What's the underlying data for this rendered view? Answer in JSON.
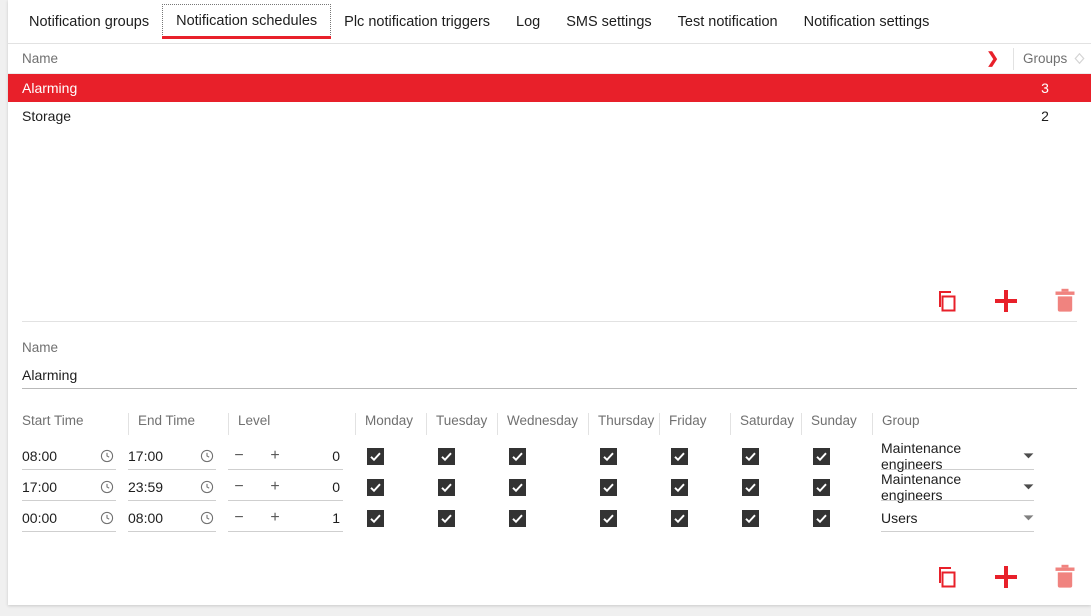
{
  "tabs": [
    {
      "label": "Notification groups",
      "active": false
    },
    {
      "label": "Notification schedules",
      "active": true
    },
    {
      "label": "Plc notification triggers",
      "active": false
    },
    {
      "label": "Log",
      "active": false
    },
    {
      "label": "SMS settings",
      "active": false
    },
    {
      "label": "Test notification",
      "active": false
    },
    {
      "label": "Notification settings",
      "active": false
    }
  ],
  "schedule_list": {
    "columns": {
      "name": "Name",
      "groups": "Groups"
    },
    "sort": {
      "name_icon": "chevron-down-icon",
      "groups_icon": "sort-diamond-icon"
    },
    "rows": [
      {
        "name": "Alarming",
        "groups": "3",
        "selected": true
      },
      {
        "name": "Storage",
        "groups": "2",
        "selected": false
      }
    ]
  },
  "list_actions": {
    "copy_label": "copy-icon",
    "add_label": "plus-icon",
    "delete_label": "trash-icon"
  },
  "detail": {
    "name_label": "Name",
    "name_value": "Alarming",
    "name_placeholder": "Name",
    "columns": {
      "start_time": "Start Time",
      "end_time": "End Time",
      "level": "Level",
      "monday": "Monday",
      "tuesday": "Tuesday",
      "wednesday": "Wednesday",
      "thursday": "Thursday",
      "friday": "Friday",
      "saturday": "Saturday",
      "sunday": "Sunday",
      "group": "Group"
    },
    "rows": [
      {
        "start_time": "08:00",
        "end_time": "17:00",
        "level": "0",
        "monday": true,
        "tuesday": true,
        "wednesday": true,
        "thursday": true,
        "friday": true,
        "saturday": true,
        "sunday": true,
        "group": "Maintenance engineers",
        "group_spread": false
      },
      {
        "start_time": "17:00",
        "end_time": "23:59",
        "level": "0",
        "monday": true,
        "tuesday": true,
        "wednesday": true,
        "thursday": true,
        "friday": true,
        "saturday": true,
        "sunday": true,
        "group": "Maintenance engineers",
        "group_spread": false
      },
      {
        "start_time": "00:00",
        "end_time": "08:00",
        "level": "1",
        "monday": true,
        "tuesday": true,
        "wednesday": true,
        "thursday": true,
        "friday": true,
        "saturday": true,
        "sunday": true,
        "group": "Users",
        "group_spread": true
      }
    ],
    "stepper": {
      "minus": "−",
      "plus": "+"
    }
  },
  "detail_actions": {
    "copy_label": "copy-icon",
    "add_label": "plus-icon",
    "delete_label": "trash-icon"
  },
  "colors": {
    "accent_red": "#e8202a",
    "accent_red_muted": "#f0837f",
    "checkbox_dark": "#333333",
    "text_muted": "#707070",
    "panel_bg": "#ffffff",
    "page_bg": "#f0f0f0"
  }
}
